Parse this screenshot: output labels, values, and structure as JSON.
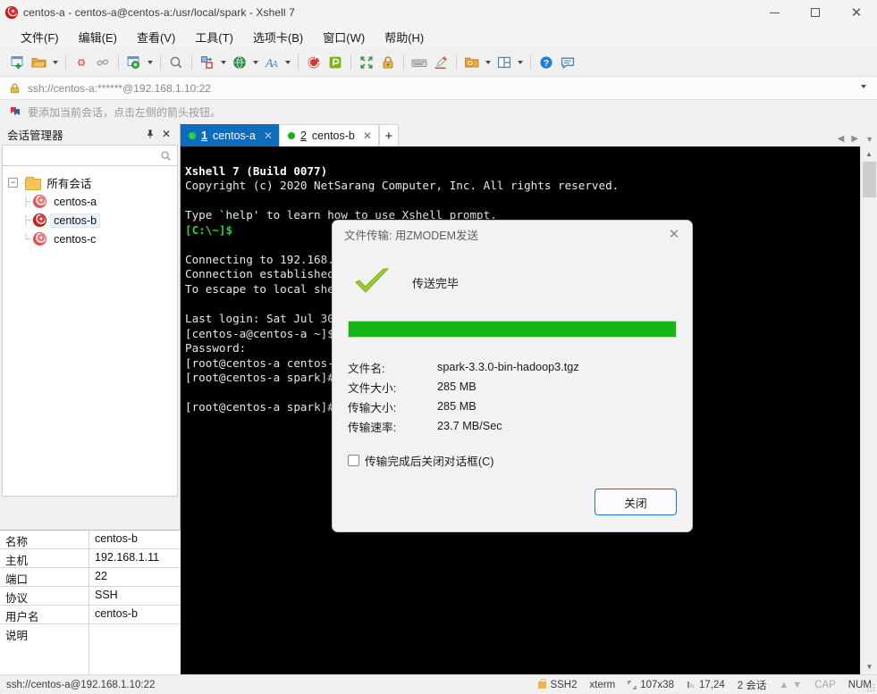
{
  "window": {
    "title": "centos-a - centos-a@centos-a:/usr/local/spark - Xshell 7",
    "app_icon": "xshell-logo-icon",
    "controls": {
      "minimize": "—",
      "maximize": "▢",
      "close": "✕"
    }
  },
  "menubar": [
    {
      "label": "文件(F)",
      "name": "menu-file"
    },
    {
      "label": "编辑(E)",
      "name": "menu-edit"
    },
    {
      "label": "查看(V)",
      "name": "menu-view"
    },
    {
      "label": "工具(T)",
      "name": "menu-tools"
    },
    {
      "label": "选项卡(B)",
      "name": "menu-tabs"
    },
    {
      "label": "窗口(W)",
      "name": "menu-window"
    },
    {
      "label": "帮助(H)",
      "name": "menu-help"
    }
  ],
  "toolbar": {
    "icons": [
      "new-session-icon",
      "open-folder-icon",
      "disconnect-icon",
      "reconnect-icon",
      "session-properties-icon",
      "find-icon",
      "transfer-file-icon",
      "globe-encoding-icon",
      "font-icon",
      "xshell-icon",
      "xftp-icon",
      "fullscreen-icon",
      "lock-icon",
      "keyboard-icon",
      "highlight-icon",
      "add-to-folder-icon",
      "layout-split-icon",
      "help-icon",
      "feedback-icon"
    ]
  },
  "address": {
    "lock_icon": "lock-icon",
    "value": "ssh://centos-a:******@192.168.1.10:22",
    "dropdown_icon": "chevron-down-icon"
  },
  "notice": {
    "icon": "bookmark-flag-icon",
    "text": "要添加当前会话，点击左侧的箭头按钮。"
  },
  "session_manager": {
    "title": "会话管理器",
    "pin_icon": "pin-icon",
    "close_icon": "close-icon",
    "search_icon": "search-icon",
    "search_placeholder": "",
    "tree": {
      "root": {
        "label": "所有会话",
        "icon": "folder-icon",
        "expander": "−"
      },
      "children": [
        {
          "label": "centos-a",
          "icon": "session-icon",
          "selected": false
        },
        {
          "label": "centos-b",
          "icon": "session-icon",
          "selected": true
        },
        {
          "label": "centos-c",
          "icon": "session-icon",
          "selected": false
        }
      ]
    },
    "properties": [
      {
        "key": "名称",
        "value": "centos-b"
      },
      {
        "key": "主机",
        "value": "192.168.1.11"
      },
      {
        "key": "端口",
        "value": "22"
      },
      {
        "key": "协议",
        "value": "SSH"
      },
      {
        "key": "用户名",
        "value": "centos-b"
      },
      {
        "key": "说明",
        "value": ""
      }
    ]
  },
  "tabs": {
    "items": [
      {
        "num": "1",
        "label": "centos-a",
        "active": true,
        "close_icon": "close-icon",
        "status_dot": "connected"
      },
      {
        "num": "2",
        "label": "centos-b",
        "active": false,
        "close_icon": "close-icon",
        "status_dot": "connected"
      }
    ],
    "add_label": "+",
    "nav_prev_icon": "chevron-left-icon",
    "nav_next_icon": "chevron-right-icon",
    "overflow_icon": "chevron-down-icon"
  },
  "terminal": {
    "lines": [
      {
        "text": "Xshell 7 (Build 0077)",
        "style": "bold"
      },
      {
        "text": "Copyright (c) 2020 NetSarang Computer, Inc. All rights reserved.",
        "style": "white"
      },
      {
        "text": "",
        "style": "white"
      },
      {
        "text": "Type `help' to learn how to use Xshell prompt.",
        "style": "white"
      },
      {
        "text": "[C:\\~]$",
        "style": "green"
      },
      {
        "text": "",
        "style": "white"
      },
      {
        "text": "Connecting to 192.168.1.10:22...",
        "style": "white"
      },
      {
        "text": "Connection established.",
        "style": "white"
      },
      {
        "text": "To escape to local shell, press 'Ctrl+Alt+]'.",
        "style": "white"
      },
      {
        "text": "",
        "style": "white"
      },
      {
        "text": "Last login: Sat Jul 30 16:22:08 2022 from 192.168.1.1",
        "style": "white"
      },
      {
        "text": "[centos-a@centos-a ~]$ su",
        "style": "white"
      },
      {
        "text": "Password:",
        "style": "white"
      },
      {
        "text": "[root@centos-a centos-a]# cd /usr/local/spark",
        "style": "white"
      },
      {
        "text": "[root@centos-a spark]# rz",
        "style": "white"
      },
      {
        "text": "",
        "style": "white"
      },
      {
        "text": "[root@centos-a spark]# ",
        "style": "white",
        "cursor": true
      }
    ]
  },
  "dialog": {
    "title": "文件传输: 用ZMODEM发送",
    "close_icon": "close-icon",
    "status_icon": "checkmark-icon",
    "status_text": "传送完毕",
    "progress_percent": 100,
    "progress_color": "#16b516",
    "fields": [
      {
        "key": "文件名:",
        "value": "spark-3.3.0-bin-hadoop3.tgz"
      },
      {
        "key": "文件大小:",
        "value": "285 MB"
      },
      {
        "key": "传输大小:",
        "value": "285 MB"
      },
      {
        "key": "传输速率:",
        "value": "23.7 MB/Sec"
      }
    ],
    "checkbox": {
      "label": "传输完成后关闭对话框(C)",
      "checked": false
    },
    "button": "关闭"
  },
  "statusbar": {
    "connection": "ssh://centos-a@192.168.1.10:22",
    "items": [
      {
        "name": "protocol",
        "icon": "lock-icon",
        "text": "SSH2"
      },
      {
        "name": "terminal-type",
        "icon": "",
        "text": "xterm"
      },
      {
        "name": "screen-size",
        "icon": "screen-icon",
        "text": "107x38"
      },
      {
        "name": "cursor-position",
        "icon": "cursor-icon",
        "text": "17,24"
      },
      {
        "name": "session-count",
        "icon": "",
        "text": "2 会话"
      }
    ],
    "upload_icon": "arrow-up-icon",
    "download_icon": "arrow-down-icon",
    "cap": "CAP",
    "num": "NUM"
  }
}
